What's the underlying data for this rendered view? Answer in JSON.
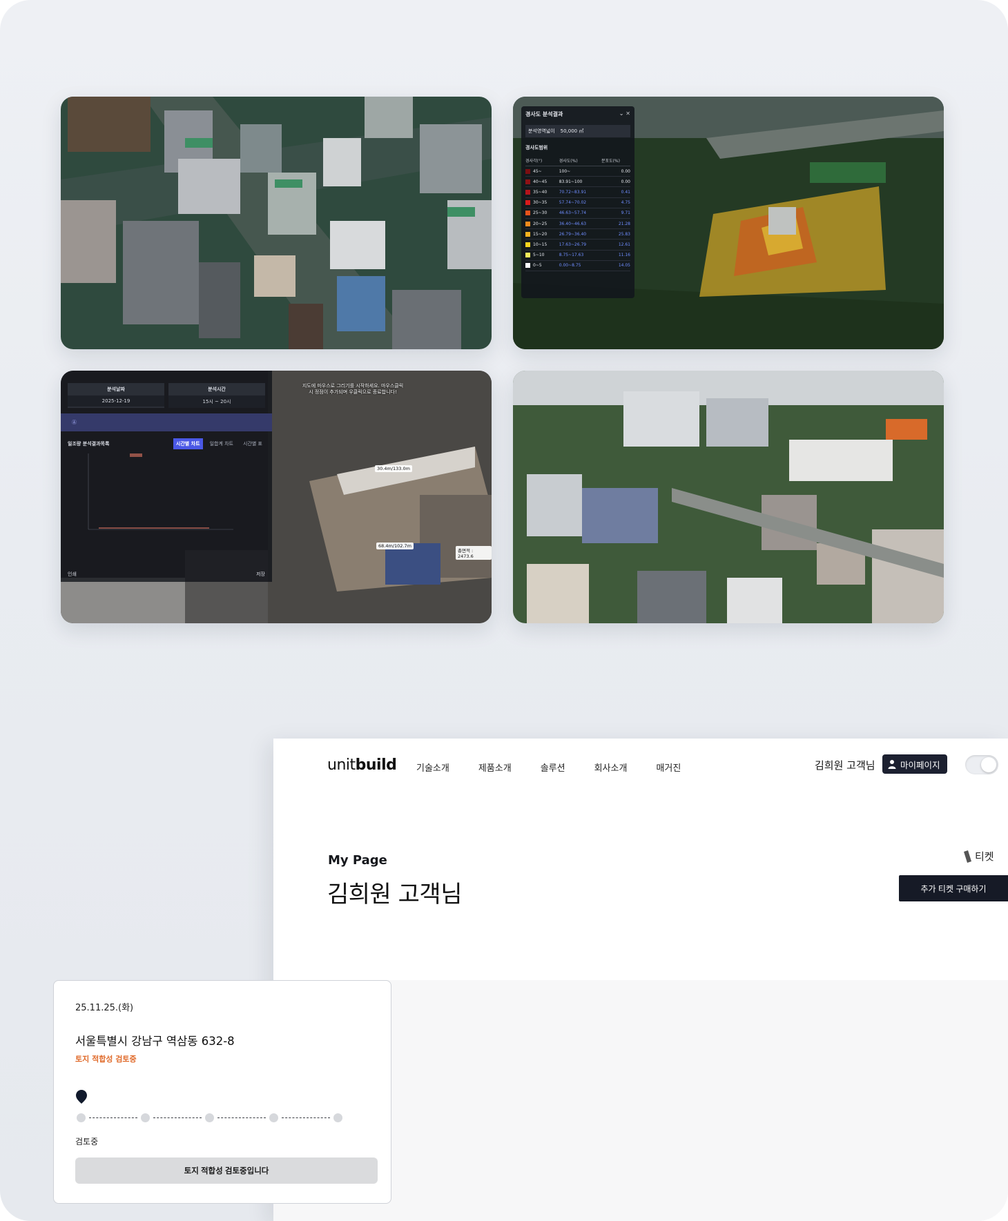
{
  "tiles": {
    "slope": {
      "title": "경사도 분석결과",
      "area_label": "분석영역넓이",
      "area_value": "50,000 ㎡",
      "range_title": "경사도범위",
      "headers": [
        "경사각(°)",
        "경사도(%)",
        "분포도(%)"
      ],
      "rows": [
        {
          "angle": "45~",
          "pct": "100~",
          "dist": "0.00",
          "color": "#7a0f12"
        },
        {
          "angle": "40~45",
          "pct": "83.91~100",
          "dist": "0.00",
          "color": "#8e1216"
        },
        {
          "angle": "35~40",
          "pct": "70.72~83.91",
          "dist": "0.41",
          "color": "#b3141b"
        },
        {
          "angle": "30~35",
          "pct": "57.74~70.02",
          "dist": "4.75",
          "color": "#d81b1b"
        },
        {
          "angle": "25~30",
          "pct": "46.63~57.74",
          "dist": "9.71",
          "color": "#e8531b"
        },
        {
          "angle": "20~25",
          "pct": "36.40~46.63",
          "dist": "21.28",
          "color": "#f08a1c"
        },
        {
          "angle": "15~20",
          "pct": "26.79~36.40",
          "dist": "25.83",
          "color": "#f5b21f"
        },
        {
          "angle": "10~15",
          "pct": "17.63~26.79",
          "dist": "12.61",
          "color": "#f7d51e"
        },
        {
          "angle": "5~10",
          "pct": "8.75~17.63",
          "dist": "11.16",
          "color": "#f5ec5a"
        },
        {
          "angle": "0~5",
          "pct": "0.00~8.75",
          "dist": "14.05",
          "color": "#ffffff"
        }
      ]
    },
    "sunlight": {
      "col1_head": "분석날짜",
      "col1_val": "2025-12-19",
      "col2_head": "분석시간",
      "col2_val": "15시 ~ 20시",
      "list_title": "일조량 분석결과목록",
      "tabs": [
        "시간별 차트",
        "일합계 차트",
        "시간별 표"
      ],
      "footer_left": "인쇄",
      "footer_right": "저장",
      "tip": "지도에 마우스로 그리기를 시작하세요. 마우스클릭시 정점이 추가되며 우클릭으로 종료합니다!",
      "dim1": "30.4m/133.0m",
      "dim2": "68.4m/102.7m",
      "dim3": "총면적 : 2473.6"
    }
  },
  "site": {
    "logo_light": "unit",
    "logo_bold": "build",
    "nav": [
      "기술소개",
      "제품소개",
      "솔루션",
      "회사소개",
      "매거진"
    ],
    "user_name": "김희원 고객님",
    "mypage_label": "마이페이지",
    "hero_sub": "My Page",
    "hero_title": "김희원 고객님",
    "ticket_label": "티켓",
    "buy_label": "추가 티켓 구매하기",
    "card": {
      "date": "25.11.25.(화)",
      "address": "서울특별시 강남구 역삼동 632-8",
      "status": "토지 적합성 검토중",
      "step_label": "검토중",
      "button": "토지 적합성 검토중입니다",
      "status_color": "#e06a2a"
    }
  }
}
